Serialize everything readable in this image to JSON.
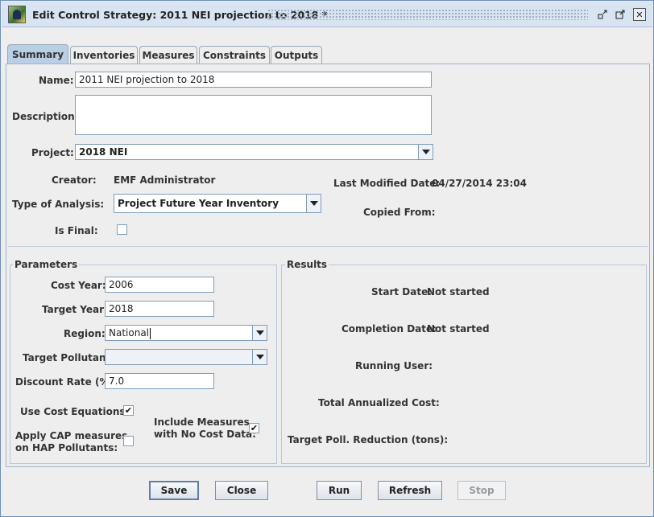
{
  "window": {
    "title": "Edit Control Strategy: 2011 NEI projection to 2018 *",
    "controls": {
      "minimize": "ᵖ",
      "restore": "⧉",
      "close": "✕"
    }
  },
  "tabs": [
    "Summary",
    "Inventories",
    "Measures",
    "Constraints",
    "Outputs"
  ],
  "summary": {
    "name_label": "Name:",
    "name_value": "2011 NEI projection to 2018",
    "description_label": "Description:",
    "description_value": "",
    "project_label": "Project:",
    "project_value": "2018 NEI",
    "creator_label": "Creator:",
    "creator_value": "EMF Administrator",
    "last_modified_label": "Last Modified Date:",
    "last_modified_value": "04/27/2014 23:04",
    "type_label": "Type of Analysis:",
    "type_value": "Project Future Year Inventory",
    "copied_from_label": "Copied From:",
    "is_final_label": "Is Final:",
    "is_final_checked": false
  },
  "parameters": {
    "title": "Parameters",
    "cost_year_label": "Cost Year:",
    "cost_year_value": "2006",
    "target_year_label": "Target Year:",
    "target_year_value": "2018",
    "region_label": "Region:",
    "region_value": "National",
    "target_pollutant_label": "Target Pollutant:",
    "target_pollutant_value": "",
    "discount_rate_label": "Discount Rate (%):",
    "discount_rate_value": "7.0",
    "use_cost_eq_label": "Use Cost Equations:",
    "use_cost_eq_checked": true,
    "apply_cap_label_1": "Apply CAP measures",
    "apply_cap_label_2": "on HAP Pollutants:",
    "apply_cap_checked": false,
    "include_measures_label_1": "Include Measures",
    "include_measures_label_2": "with No Cost Data:",
    "include_measures_checked": true
  },
  "results": {
    "title": "Results",
    "start_date_label": "Start Date:",
    "start_date_value": "Not started",
    "completion_date_label": "Completion Date:",
    "completion_date_value": "Not started",
    "running_user_label": "Running User:",
    "total_cost_label": "Total Annualized Cost:",
    "target_reduction_label": "Target Poll. Reduction (tons):"
  },
  "buttons": {
    "save": "Save",
    "close": "Close",
    "run": "Run",
    "refresh": "Refresh",
    "stop": "Stop"
  },
  "colors": {
    "active_tab": "#b8cfe5",
    "titlebar": "#d8e4f2",
    "panel_border": "#9fb3c8"
  }
}
